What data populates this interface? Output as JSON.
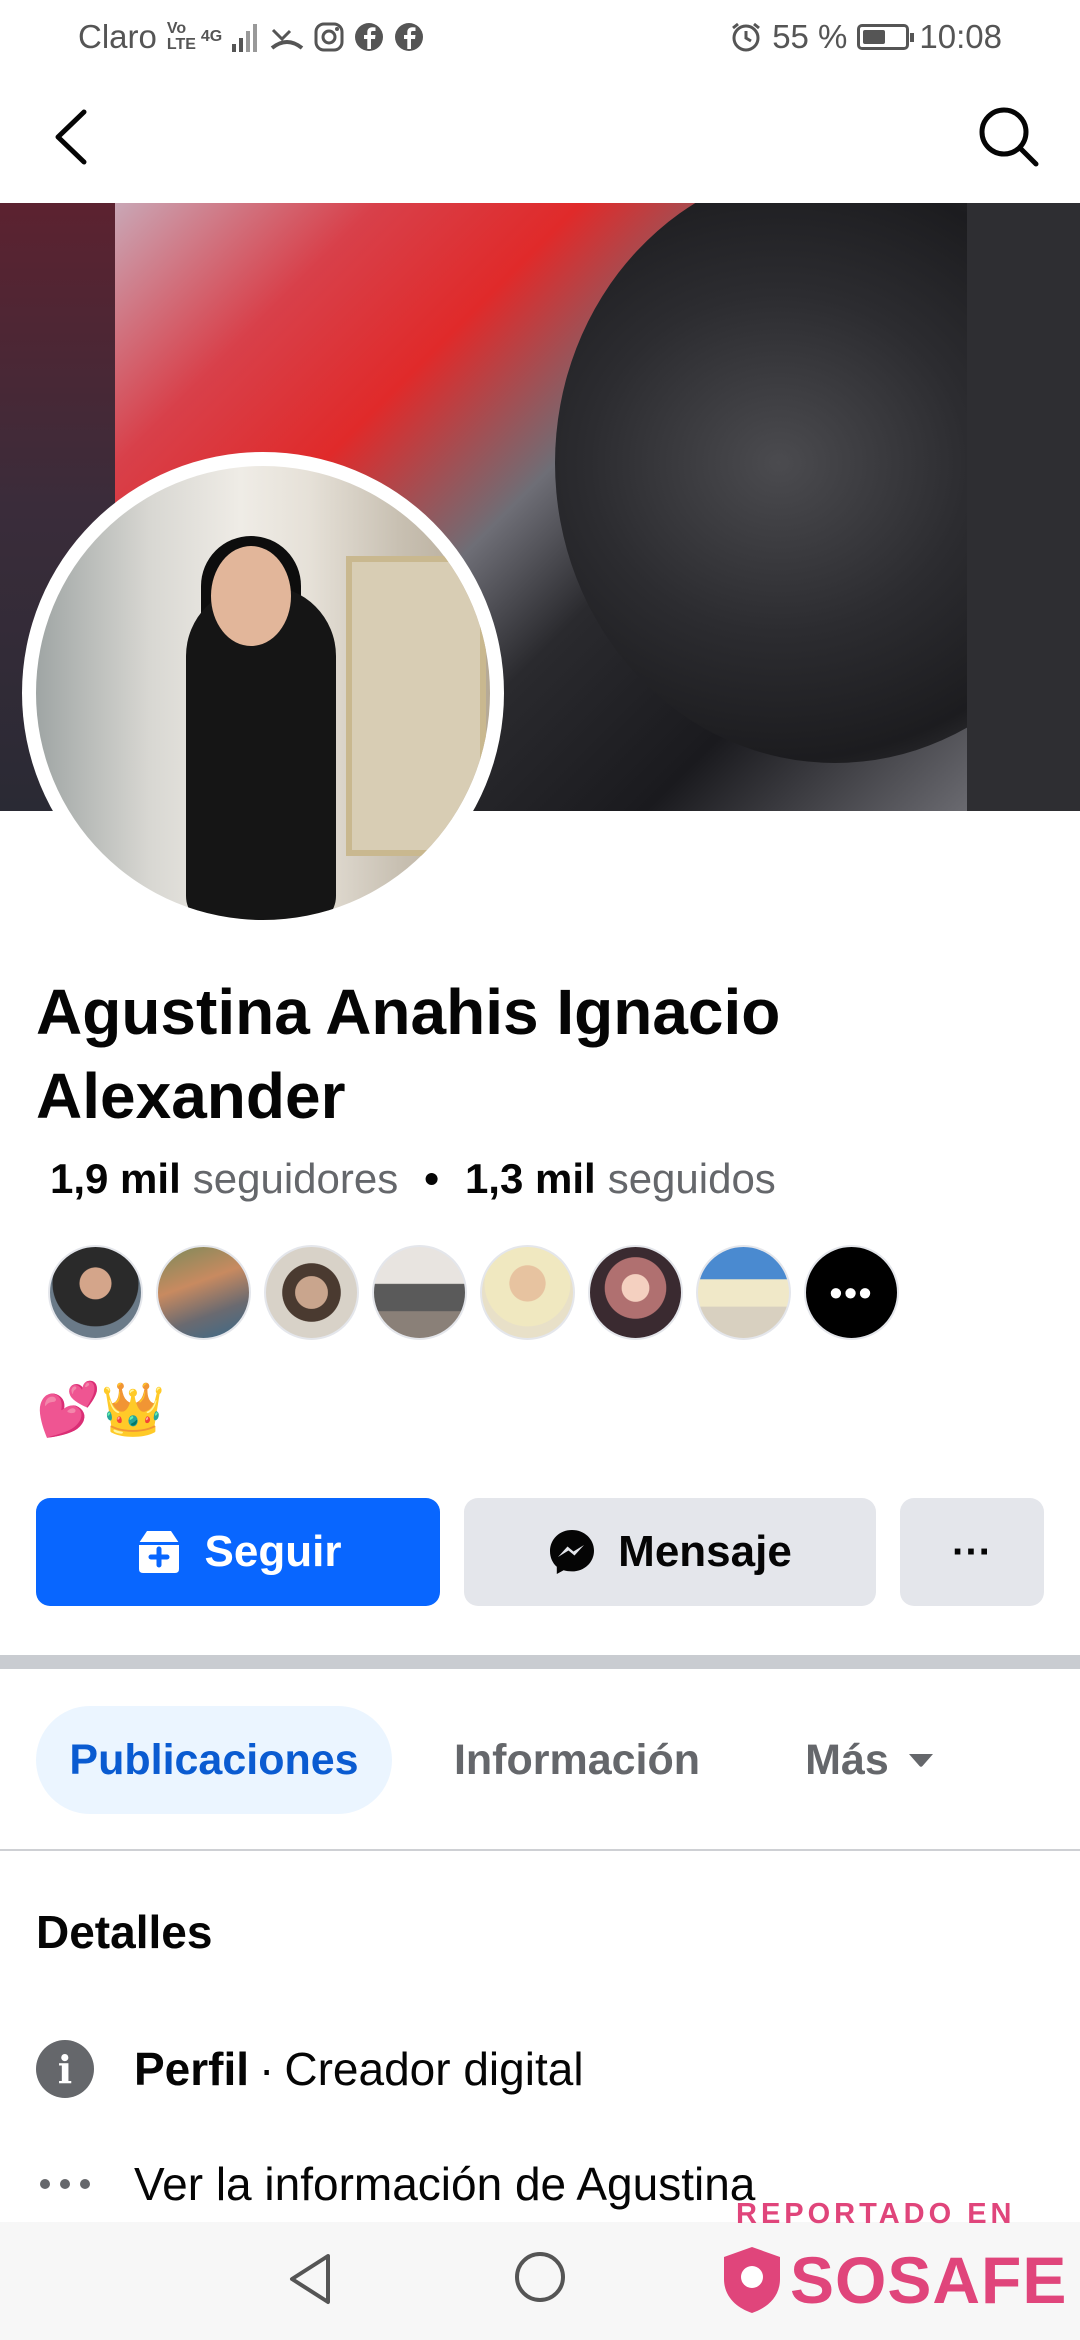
{
  "status_bar": {
    "carrier": "Claro",
    "network_volte": "Vo LTE",
    "network_type": "4G",
    "battery": "55 %",
    "battery_level": 0.55,
    "time": "10:08"
  },
  "top_nav": {
    "back_icon": "back-arrow-icon",
    "search_icon": "search-icon"
  },
  "profile": {
    "name": "Agustina Anahis Ignacio Alexander",
    "followers_count": "1,9 mil",
    "followers_label": "seguidores",
    "separator": "•",
    "following_count": "1,3 mil",
    "following_label": "seguidos",
    "bio": "💕👑",
    "more_followers_glyph": "•••"
  },
  "actions": {
    "follow_label": "Seguir",
    "message_label": "Mensaje",
    "more_label": "···"
  },
  "tabs": [
    {
      "label": "Publicaciones",
      "active": true
    },
    {
      "label": "Información",
      "active": false
    },
    {
      "label": "Más",
      "active": false
    }
  ],
  "details": {
    "title": "Detalles",
    "profile_label": "Perfil",
    "profile_separator": "·",
    "profile_value": "Creador digital",
    "view_info_label": "Ver la información de Agustina"
  },
  "watermark": {
    "top": "REPORTADO EN",
    "brand": "SOSAFE"
  },
  "colors": {
    "accent": "#0866ff",
    "tab_active_bg": "#ebf5ff",
    "tab_active_text": "#0a5bd1",
    "watermark": "#e0457b"
  }
}
